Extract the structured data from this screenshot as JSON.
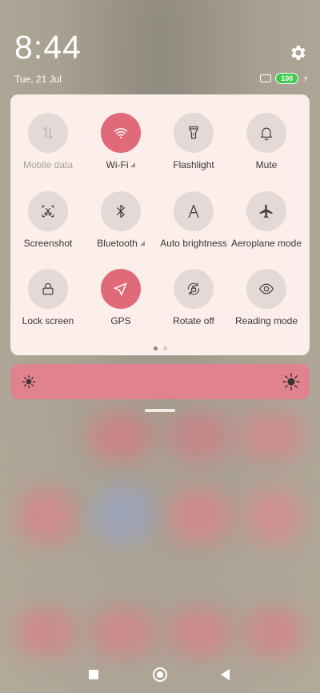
{
  "status": {
    "time": "8:44",
    "date": "Tue, 21 Jul",
    "battery": "100"
  },
  "tiles": [
    {
      "label": "Mobile data",
      "icon": "mobile-data-icon",
      "active": false,
      "disabled": true,
      "signal": false
    },
    {
      "label": "Wi-Fi",
      "icon": "wifi-icon",
      "active": true,
      "disabled": false,
      "signal": true
    },
    {
      "label": "Flashlight",
      "icon": "flashlight-icon",
      "active": false,
      "disabled": false,
      "signal": false
    },
    {
      "label": "Mute",
      "icon": "bell-icon",
      "active": false,
      "disabled": false,
      "signal": false
    },
    {
      "label": "Screenshot",
      "icon": "screenshot-icon",
      "active": false,
      "disabled": false,
      "signal": false
    },
    {
      "label": "Bluetooth",
      "icon": "bluetooth-icon",
      "active": false,
      "disabled": false,
      "signal": true
    },
    {
      "label": "Auto brightness",
      "icon": "auto-brightness-icon",
      "active": false,
      "disabled": false,
      "signal": false
    },
    {
      "label": "Aeroplane mode",
      "icon": "airplane-icon",
      "active": false,
      "disabled": false,
      "signal": false
    },
    {
      "label": "Lock screen",
      "icon": "lock-icon",
      "active": false,
      "disabled": false,
      "signal": false
    },
    {
      "label": "GPS",
      "icon": "location-arrow-icon",
      "active": true,
      "disabled": false,
      "signal": false
    },
    {
      "label": "Rotate off",
      "icon": "rotate-lock-icon",
      "active": false,
      "disabled": false,
      "signal": false
    },
    {
      "label": "Reading mode",
      "icon": "eye-icon",
      "active": false,
      "disabled": false,
      "signal": false
    }
  ],
  "page_indicator": {
    "pages": 2,
    "current": 1
  },
  "brightness": {
    "level": 1.0
  },
  "colors": {
    "accent": "#e06a78",
    "panel": "#fcefeb",
    "brightness_bar": "#e1838e",
    "battery": "#3fcb4b"
  }
}
